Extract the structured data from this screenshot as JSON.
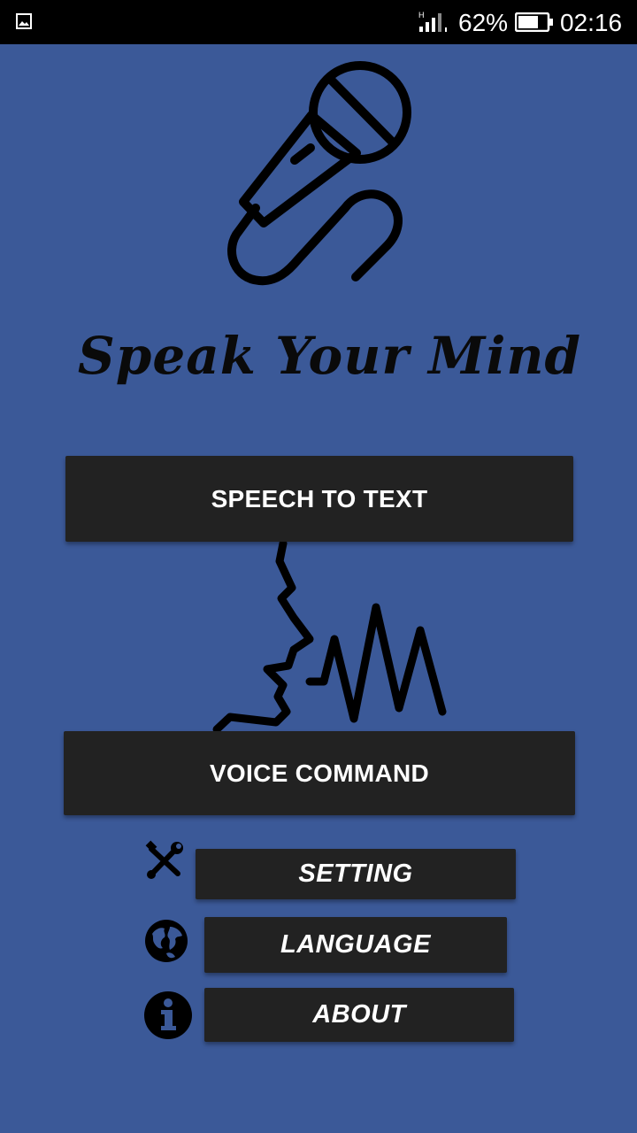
{
  "status_bar": {
    "battery_percent": "62%",
    "time": "02:16",
    "network_label": "H",
    "icons": [
      "gallery-icon",
      "signal-icon",
      "battery-icon"
    ]
  },
  "app": {
    "title": "Speak Your Mind",
    "background_color": "#3b5998",
    "button_color": "#222222"
  },
  "buttons": {
    "speech_to_text": "SPEECH TO TEXT",
    "voice_command": "VOICE COMMAND",
    "setting": "SETTING",
    "language": "LANGUAGE",
    "about": "ABOUT"
  },
  "icons": {
    "logo": "microphone-icon",
    "art": "voice-wave-icon",
    "setting": "tools-icon",
    "language": "globe-icon",
    "about": "info-icon"
  }
}
